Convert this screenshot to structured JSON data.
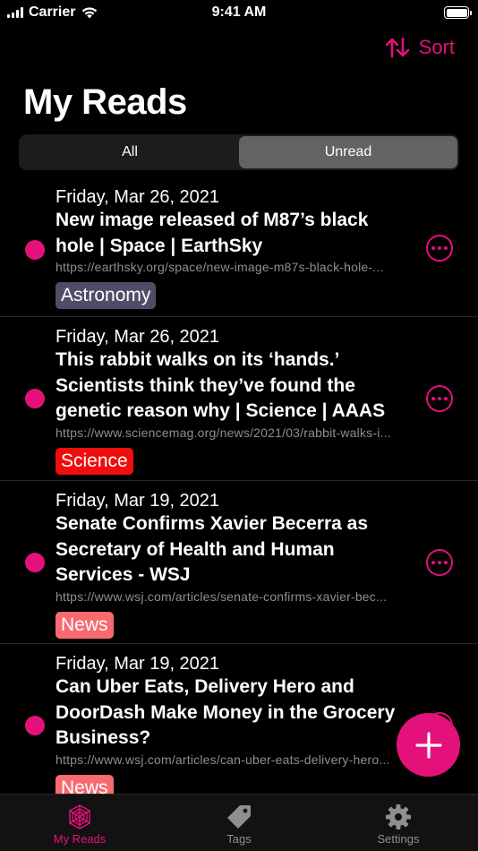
{
  "status_bar": {
    "carrier": "Carrier",
    "time": "9:41 AM"
  },
  "header": {
    "sort_label": "Sort",
    "title": "My Reads"
  },
  "segments": [
    {
      "label": "All",
      "active": false
    },
    {
      "label": "Unread",
      "active": true
    }
  ],
  "items": [
    {
      "date": "Friday, Mar 26, 2021",
      "title": "New image released of M87’s black hole | Space | EarthSky",
      "url": "https://earthsky.org/space/new-image-m87s-black-hole-...",
      "tag": "Astronomy",
      "tag_color": "#4f4d66"
    },
    {
      "date": "Friday, Mar 26, 2021",
      "title": "This rabbit walks on its ‘hands.’ Scientists think they’ve found the genetic reason why | Science | AAAS",
      "url": "https://www.sciencemag.org/news/2021/03/rabbit-walks-i...",
      "tag": "Science",
      "tag_color": "#f00d0d"
    },
    {
      "date": "Friday, Mar 19, 2021",
      "title": "Senate Confirms Xavier Becerra as Secretary of Health and Human Services  - WSJ",
      "url": "https://www.wsj.com/articles/senate-confirms-xavier-bec...",
      "tag": "News",
      "tag_color": "#f76a70"
    },
    {
      "date": "Friday, Mar 19, 2021",
      "title": "Can Uber Eats, Delivery Hero and DoorDash Make Money in the Grocery Business?",
      "url": "https://www.wsj.com/articles/can-uber-eats-delivery-hero...",
      "tag": "News",
      "tag_color": "#f76a70"
    }
  ],
  "tabbar": [
    {
      "label": "My Reads",
      "icon": "my-reads-icon",
      "active": true
    },
    {
      "label": "Tags",
      "icon": "tag-icon",
      "active": false
    },
    {
      "label": "Settings",
      "icon": "gear-icon",
      "active": false
    }
  ],
  "accent_color": "#e5117a"
}
